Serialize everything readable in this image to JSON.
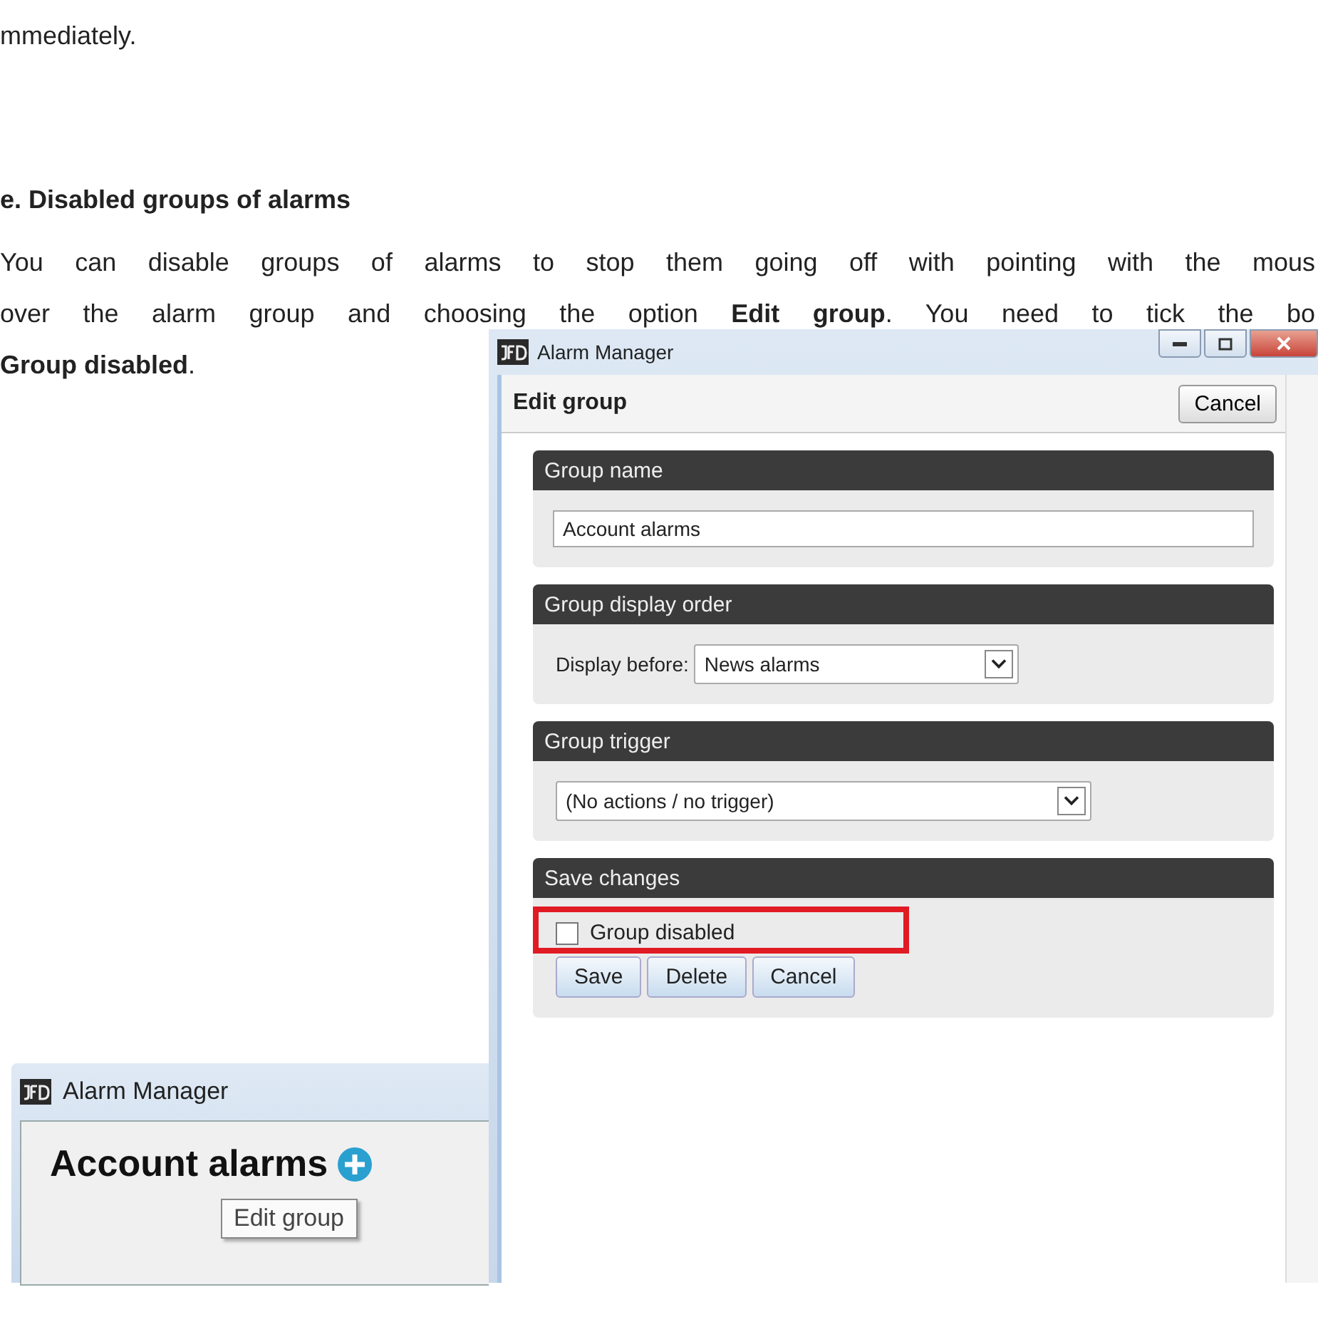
{
  "document": {
    "intro": "mmediately.",
    "heading": "e. Disabled groups of alarms",
    "paragraph_lines": [
      "You can disable groups of alarms to stop them going off with pointing with the mous",
      "over the alarm group and choosing the option **Edit group**. You need to tick the bo",
      "**Group disabled**."
    ]
  },
  "small_window": {
    "title": "Alarm Manager",
    "group_title": "Account alarms",
    "tooltip": "Edit group"
  },
  "edit_window": {
    "title": "Alarm Manager",
    "header": "Edit group",
    "header_button": "Cancel",
    "sections": [
      {
        "kind": "text_field",
        "title": "Group name",
        "value": "Account alarms"
      },
      {
        "kind": "select",
        "title": "Group display order",
        "label": "Display before:",
        "value": "News alarms"
      },
      {
        "kind": "select",
        "title": "Group trigger",
        "value": "(No actions / no trigger)"
      },
      {
        "kind": "save",
        "title": "Save changes",
        "checkbox": {
          "label": "Group disabled",
          "checked": false,
          "highlighted": true
        },
        "buttons": [
          "Save",
          "Delete",
          "Cancel"
        ]
      }
    ]
  }
}
